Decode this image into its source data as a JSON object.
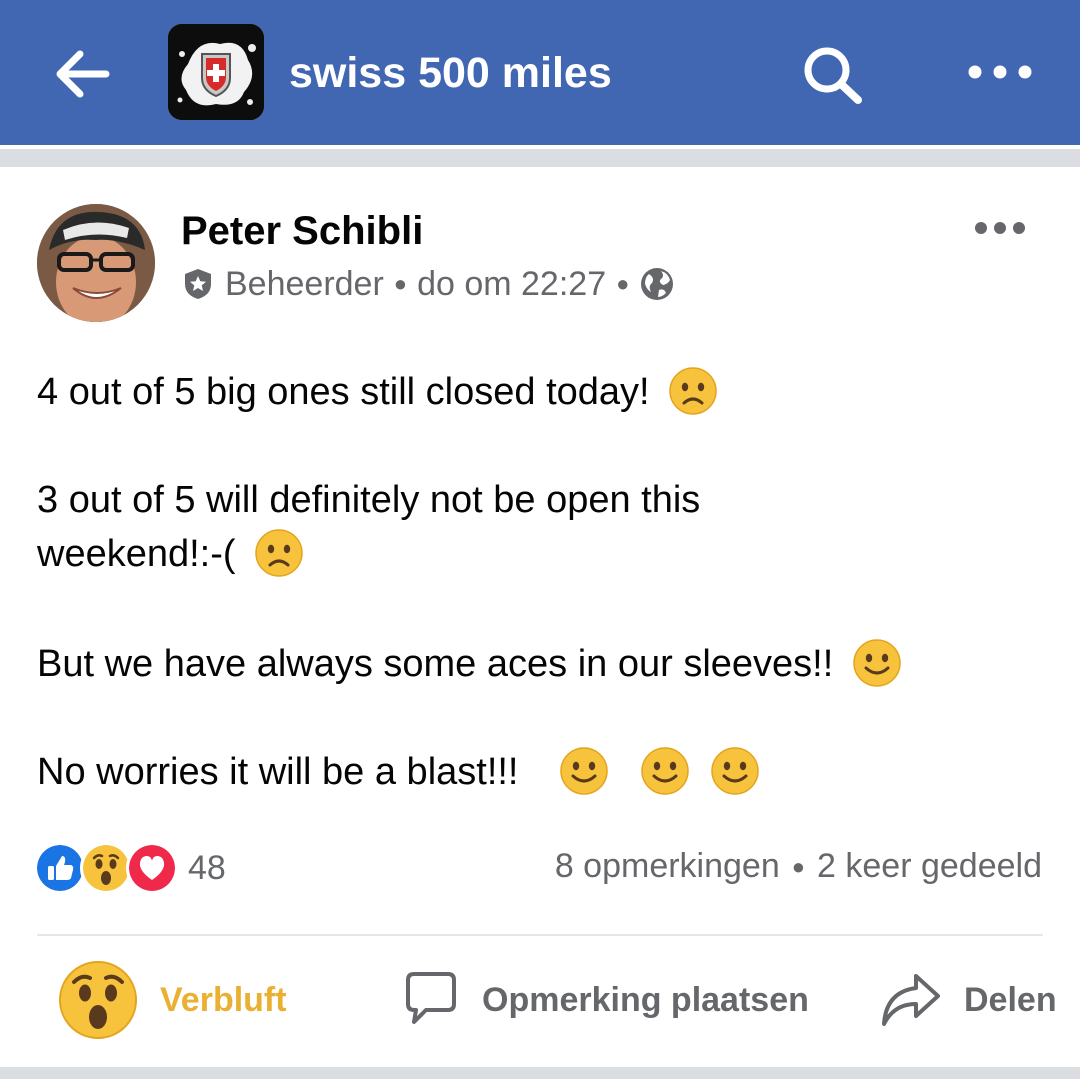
{
  "header": {
    "group_title": "swiss 500 miles",
    "icons": [
      "back-arrow-icon",
      "search-icon",
      "more-icon"
    ],
    "bar_color": "#4267b2"
  },
  "post": {
    "author": "Peter Schibli",
    "role": "Beheerder",
    "time": "do om 22:27",
    "paragraphs": [
      "4 out of 5 big ones still closed today!",
      "3 out of 5 will definitely not be open this weekend!:-(",
      "But we have always some aces in our sleeves!!",
      "No worries it will be a blast!!!"
    ],
    "reaction_count": "48",
    "comments": "8 opmerkingen",
    "shares": "2 keer gedeeld"
  },
  "actions": {
    "react_label": "Verbluft",
    "comment_label": "Opmerking plaatsen",
    "share_label": "Delen",
    "react_color": "#e9b032"
  }
}
